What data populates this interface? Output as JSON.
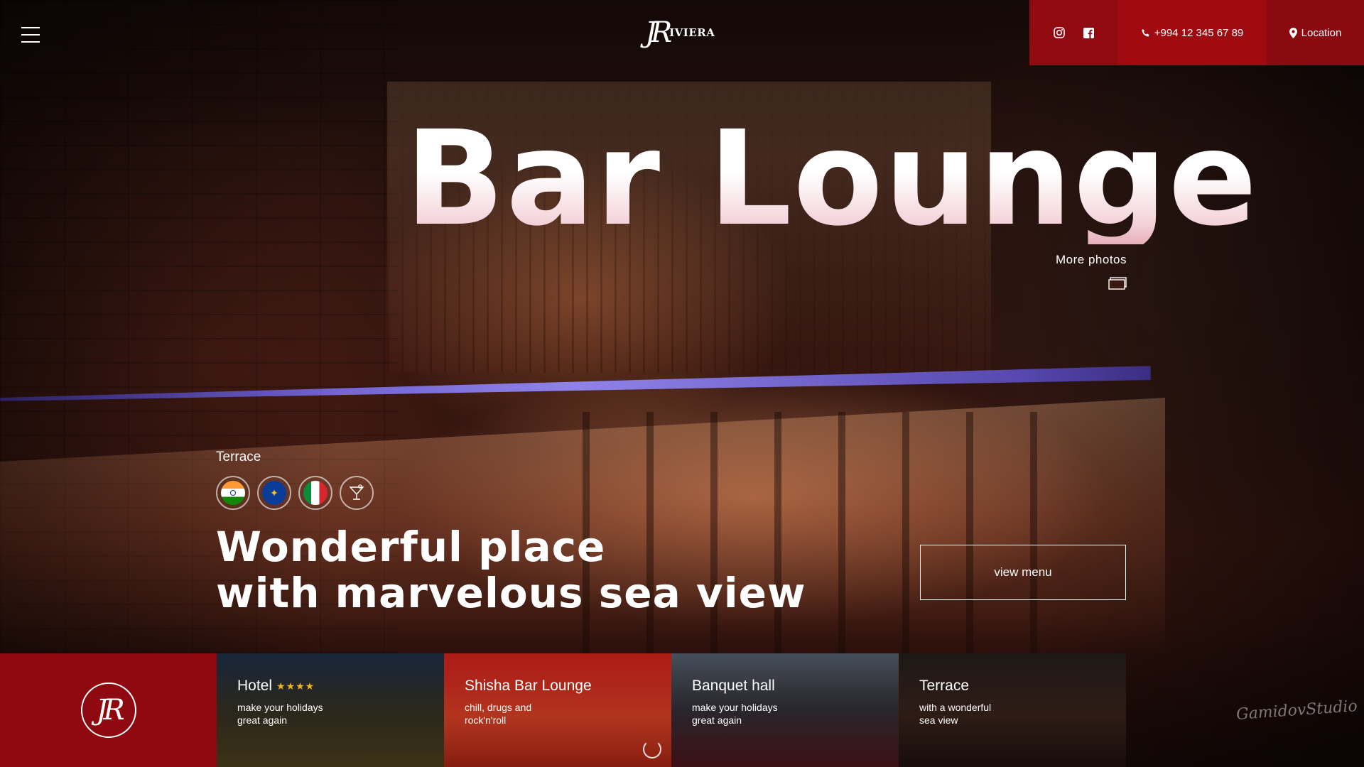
{
  "header": {
    "brand": {
      "mark": "JR",
      "name": "IVIERA"
    },
    "social": [
      {
        "name": "instagram-icon",
        "label": "Instagram"
      },
      {
        "name": "facebook-icon",
        "label": "Facebook"
      }
    ],
    "phone": "+994 12 345 67 89",
    "location": "Location"
  },
  "hero": {
    "title": "Bar Lounge",
    "more_photos": "More photos",
    "category": "Terrace",
    "flags": [
      "india-flag-icon",
      "eu-flag-icon",
      "italy-flag-icon",
      "cocktail-icon"
    ],
    "tagline_line1": "Wonderful place",
    "tagline_line2": "with marvelous sea view",
    "cta": "view menu"
  },
  "strip": {
    "brand_mark": "JR",
    "cards": [
      {
        "title": "Hotel",
        "stars": "★★★★",
        "sub_line1": "make your holidays",
        "sub_line2": "great again"
      },
      {
        "title": "Shisha Bar Lounge",
        "sub_line1": "chill, drugs and",
        "sub_line2": "rock'n'roll"
      },
      {
        "title": "Banquet hall",
        "sub_line1": "make your holidays",
        "sub_line2": "great again"
      },
      {
        "title": "Terrace",
        "sub_line1": "with a wonderful",
        "sub_line2": "sea view"
      }
    ]
  },
  "footer": {
    "studio": "GamidovStudio"
  },
  "colors": {
    "accent": "#8f0a10",
    "accent_light": "#a00b12",
    "star": "#f0b41c"
  }
}
